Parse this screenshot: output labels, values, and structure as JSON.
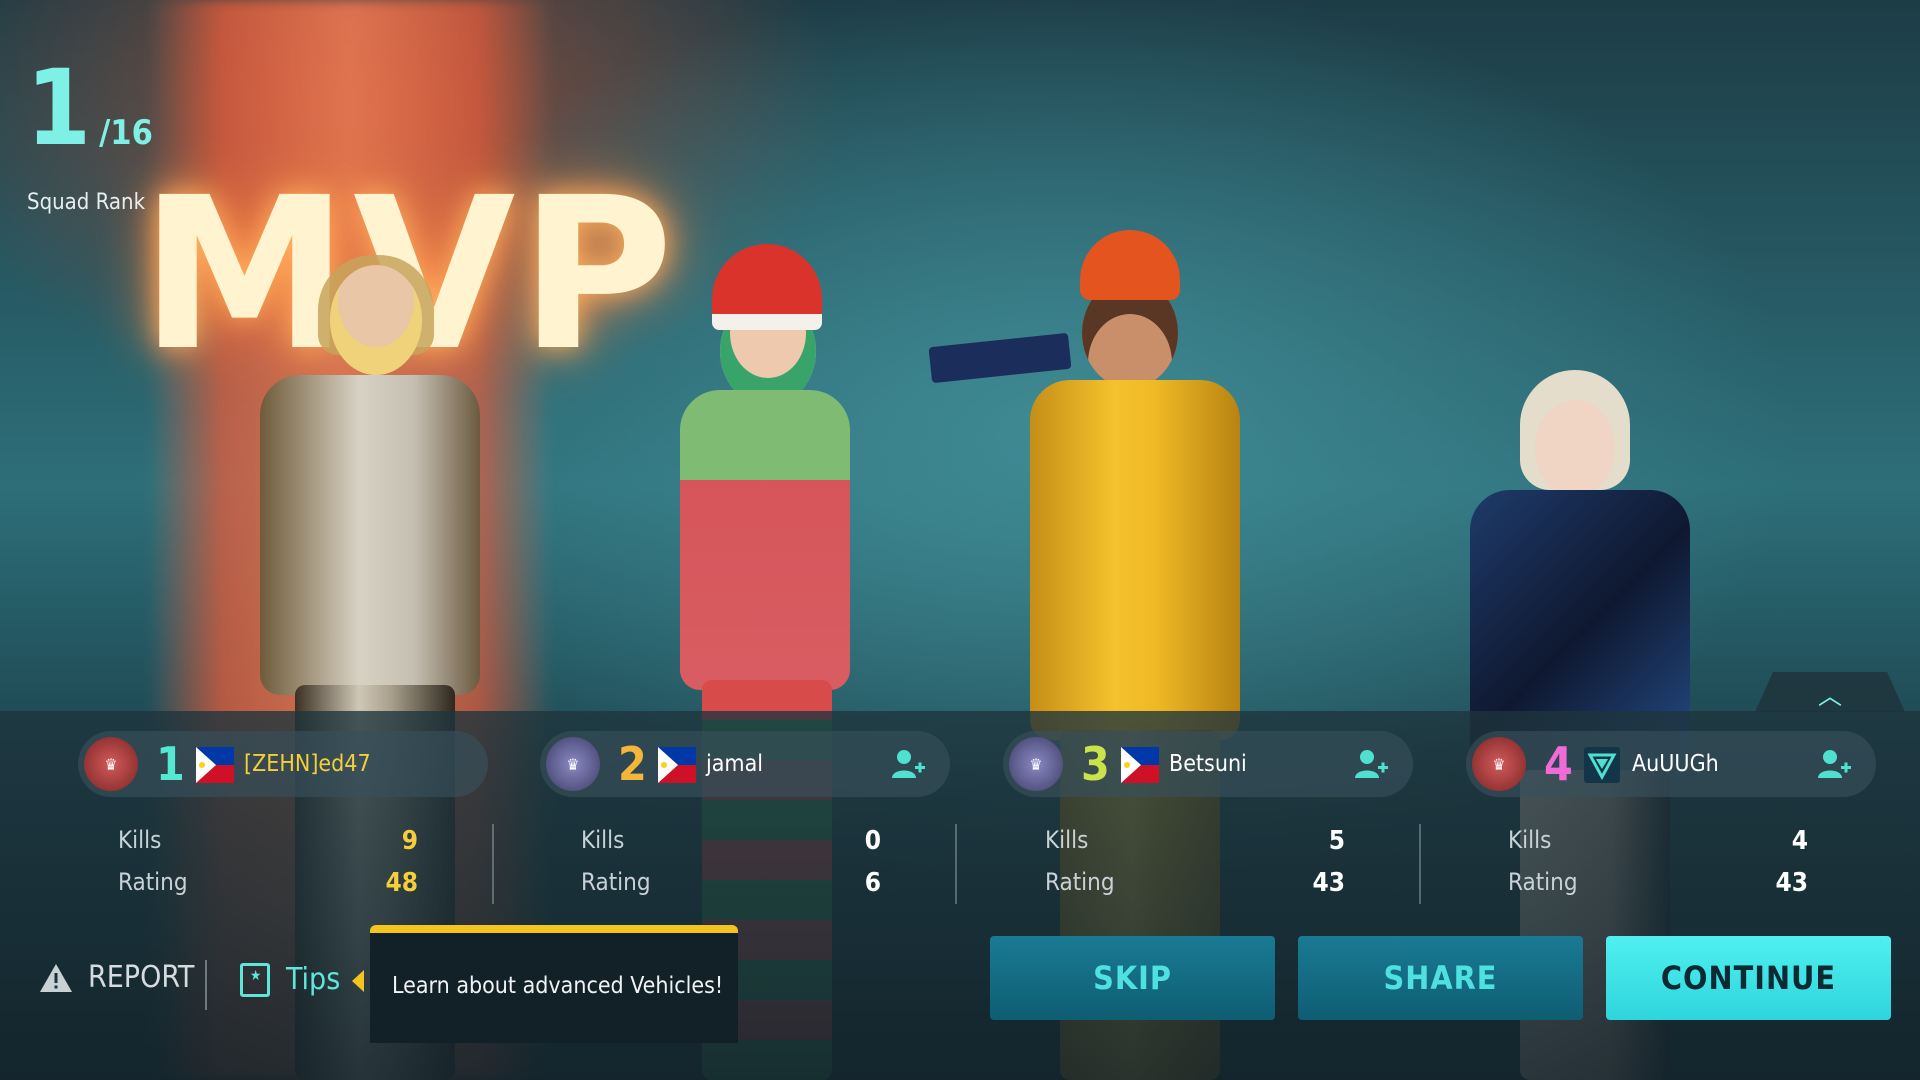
{
  "squad_rank": {
    "position": "1",
    "total": "/16",
    "label": "Squad Rank"
  },
  "banner": {
    "text": "MVP"
  },
  "players": [
    {
      "rank": "1",
      "name": "[ZEHN]ed47",
      "country_flag": "philippines-flag",
      "kills_label": "Kills",
      "kills": "9",
      "rating_label": "Rating",
      "rating": "48",
      "rank_color": "#55e8d0",
      "value_color": "#f4cf3a",
      "name_color": "#f4cf3a",
      "emblem_color": "#b03838",
      "add_friend": false
    },
    {
      "rank": "2",
      "name": "jamal",
      "country_flag": "philippines-flag",
      "kills_label": "Kills",
      "kills": "0",
      "rating_label": "Rating",
      "rating": "6",
      "rank_color": "#f2b63a",
      "value_color": "#ffffff",
      "name_color": "#e8eef0",
      "emblem_color": "#5b5a8c",
      "add_friend": true
    },
    {
      "rank": "3",
      "name": "Betsuni",
      "country_flag": "philippines-flag",
      "kills_label": "Kills",
      "kills": "5",
      "rating_label": "Rating",
      "rating": "43",
      "rank_color": "#c9e44a",
      "value_color": "#ffffff",
      "name_color": "#e8eef0",
      "emblem_color": "#5b5a8c",
      "add_friend": true
    },
    {
      "rank": "4",
      "name": "AuUUGh",
      "country_flag": "team-logo",
      "kills_label": "Kills",
      "kills": "4",
      "rating_label": "Rating",
      "rating": "43",
      "rank_color": "#f06ad8",
      "value_color": "#ffffff",
      "name_color": "#e8eef0",
      "emblem_color": "#b03838",
      "add_friend": true
    }
  ],
  "footer": {
    "report_label": "REPORT",
    "tips_label": "Tips",
    "tip_text": "Learn about advanced Vehicles!",
    "skip_label": "SKIP",
    "share_label": "SHARE",
    "continue_label": "CONTINUE"
  },
  "colors": {
    "accent": "#4ff0ef",
    "tip_accent": "#f4c51c",
    "rank_text": "#7ff0e6"
  }
}
